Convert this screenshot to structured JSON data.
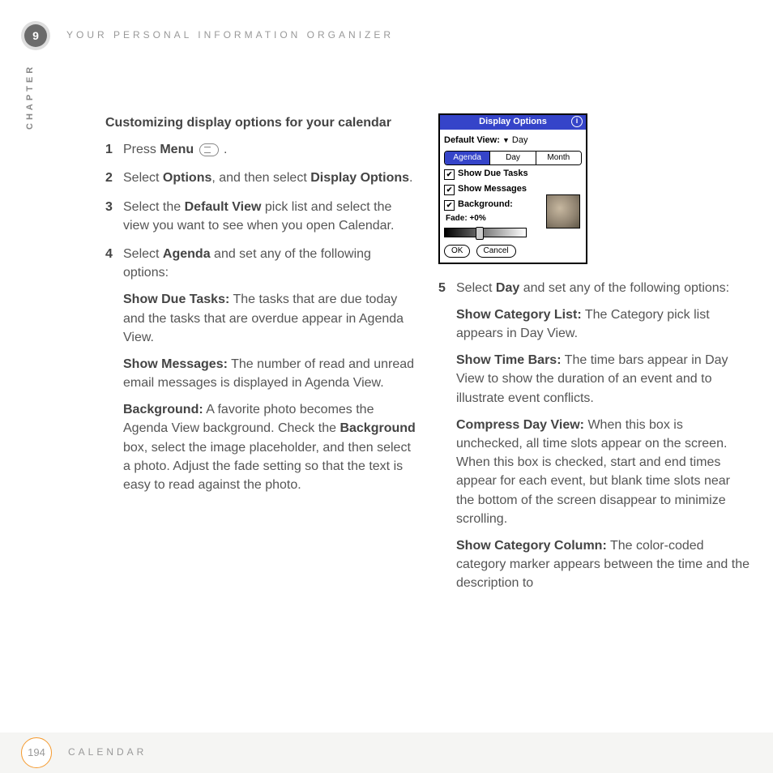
{
  "header": {
    "chapter_number": "9",
    "title": "YOUR PERSONAL INFORMATION ORGANIZER",
    "chapter_label": "CHAPTER"
  },
  "section_title": "Customizing display options for your calendar",
  "steps": {
    "s1": {
      "num": "1",
      "prefix": "Press ",
      "bold": "Menu",
      "suffix": " ."
    },
    "s2": {
      "num": "2",
      "prefix": "Select ",
      "bold1": "Options",
      "mid": ", and then select ",
      "bold2": "Display Options",
      "suffix": "."
    },
    "s3": {
      "num": "3",
      "prefix": "Select the ",
      "bold": "Default View",
      "suffix": " pick list and select the view you want to see when you open Calendar."
    },
    "s4": {
      "num": "4",
      "prefix": "Select ",
      "bold": "Agenda",
      "suffix": " and set any of the following options:"
    },
    "s5": {
      "num": "5",
      "prefix": "Select ",
      "bold": "Day",
      "suffix": " and set any of the following options:"
    }
  },
  "options_left": {
    "due_tasks": {
      "label": "Show Due Tasks:",
      "text": " The tasks that are due today and the tasks that are overdue appear in Agenda View."
    },
    "messages": {
      "label": "Show Messages:",
      "text": " The number of read and unread email messages is displayed in Agenda View."
    },
    "background": {
      "label": "Background:",
      "text_a": " A favorite photo becomes the Agenda View background. Check the ",
      "bold": "Background",
      "text_b": " box, select the image placeholder, and then select a photo. Adjust the fade setting so that the text is easy to read against the photo."
    }
  },
  "options_right": {
    "cat_list": {
      "label": "Show Category List:",
      "text": " The Category pick list appears in Day View."
    },
    "time_bars": {
      "label": "Show Time Bars:",
      "text": " The time bars appear in Day View to show the duration of an event and to illustrate event conflicts."
    },
    "compress": {
      "label": "Compress Day View:",
      "text": " When this box is unchecked, all time slots appear on the screen. When this box is checked, start and end times appear for each event, but blank time slots near the bottom of the screen disappear to minimize scrolling."
    },
    "cat_col": {
      "label": "Show Category Column:",
      "text": " The color-coded category marker appears between the time and the description to"
    }
  },
  "panel": {
    "title": "Display Options",
    "info": "i",
    "default_label": "Default View:",
    "default_value": "Day",
    "tabs": {
      "agenda": "Agenda",
      "day": "Day",
      "month": "Month"
    },
    "chk1": "Show Due Tasks",
    "chk2": "Show Messages",
    "chk3": "Background:",
    "fade_label": "Fade:",
    "fade_value": "+0%",
    "ok": "OK",
    "cancel": "Cancel"
  },
  "footer": {
    "page": "194",
    "label": "CALENDAR"
  }
}
